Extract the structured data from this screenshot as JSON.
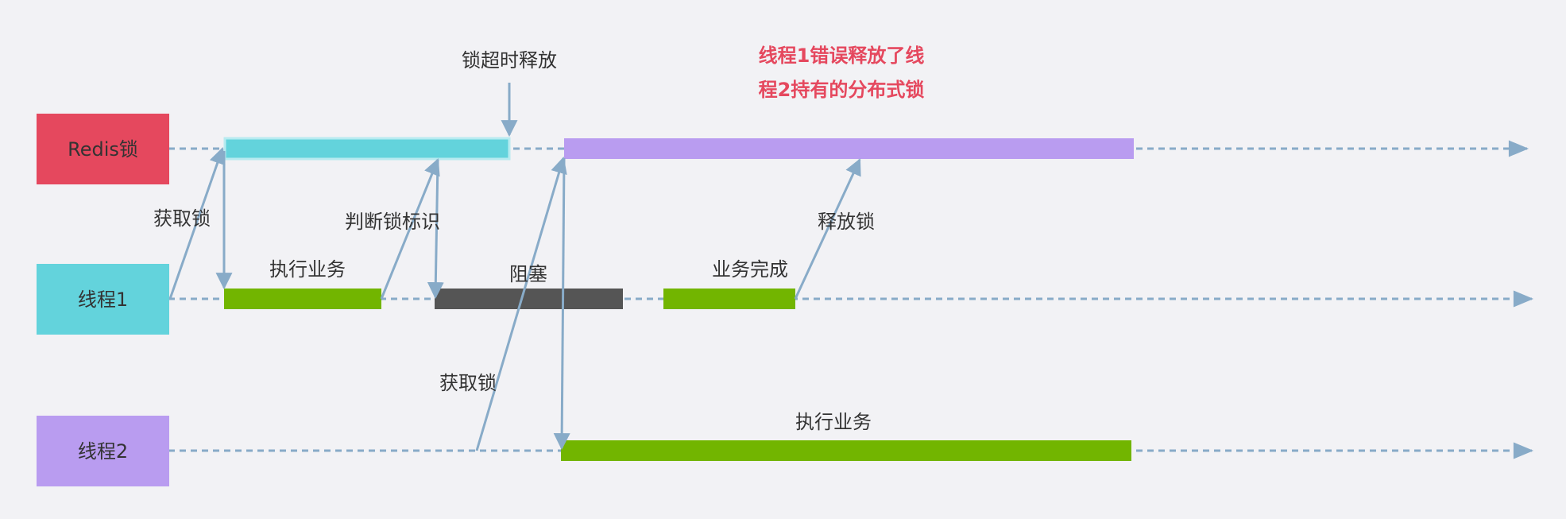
{
  "lanes": {
    "redis": "Redis锁",
    "thread1": "线程1",
    "thread2": "线程2"
  },
  "labels": {
    "lock_timeout_release": "锁超时释放",
    "warning_line1": "线程1错误释放了线",
    "warning_line2": "程2持有的分布式锁",
    "t1_acquire_lock": "获取锁",
    "t1_execute_business": "执行业务",
    "t1_check_lock_id": "判断锁标识",
    "t1_blocked": "阻塞",
    "t1_business_done": "业务完成",
    "t1_release_lock": "释放锁",
    "t2_acquire_lock": "获取锁",
    "t2_execute_business": "执行业务"
  },
  "colors": {
    "redis_box": "#e5485e",
    "thread1_box": "#63d3dc",
    "thread2_box": "#b99cf0",
    "redis_lock_t1": "#63d3dc",
    "redis_lock_t2": "#b99cf0",
    "business_bar": "#72b500",
    "blocked_bar": "#555555",
    "connector": "#88abc8",
    "warning_text": "#e5485e"
  }
}
